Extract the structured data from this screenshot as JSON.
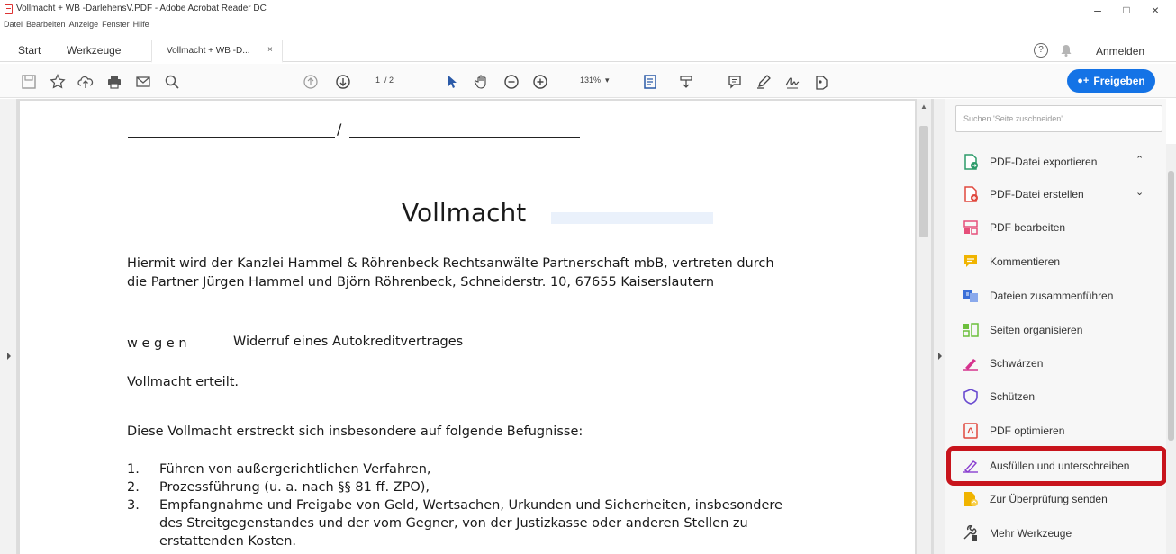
{
  "window": {
    "title": "Vollmacht + WB -DarlehensV.PDF - Adobe Acrobat Reader DC",
    "minimize": "–",
    "maximize": "□",
    "close": "×"
  },
  "menu": [
    "Datei",
    "Bearbeiten",
    "Anzeige",
    "Fenster",
    "Hilfe"
  ],
  "tabs": {
    "home": "Start",
    "tools": "Werkzeuge",
    "document": "Vollmacht + WB -D...",
    "document_close": "×",
    "signin": "Anmelden"
  },
  "toolbar": {
    "page_current": "1",
    "page_total": "/ 2",
    "zoom": "131%",
    "share_label": "Freigeben"
  },
  "document": {
    "blank_separator": "/",
    "heading": "Vollmacht",
    "intro_line1": "Hiermit wird der Kanzlei Hammel & Röhrenbeck Rechtsanwälte Partnerschaft mbB, vertreten durch",
    "intro_line2": "die Partner Jürgen Hammel und Björn Röhrenbeck, Schneiderstr. 10, 67655 Kaiserslautern",
    "wegen_label": "w e g e n",
    "wegen_value": "Widerruf eines Autokreditvertrages",
    "granted": "Vollmacht erteilt.",
    "scope_intro": "Diese Vollmacht erstreckt sich insbesondere auf folgende Befugnisse:",
    "items": [
      {
        "num": "1.",
        "text": "Führen von außergerichtlichen Verfahren,"
      },
      {
        "num": "2.",
        "text": "Prozessführung (u. a. nach §§ 81 ff. ZPO),"
      },
      {
        "num": "3.",
        "text": "Empfangnahme und Freigabe von Geld, Wertsachen,  Urkunden und Sicherheiten, insbesondere"
      }
    ],
    "item3_line2": "des Streitgegenstandes und der vom Gegner, von der Justizkasse oder anderen Stellen zu",
    "item3_line3": "erstattenden Kosten."
  },
  "tools_panel": {
    "search_placeholder": "Suchen 'Seite zuschneiden'",
    "items": [
      {
        "label": "PDF-Datei exportieren",
        "icon": "export-pdf-icon",
        "chevron": "^"
      },
      {
        "label": "PDF-Datei erstellen",
        "icon": "create-pdf-icon",
        "chevron": "v"
      },
      {
        "label": "PDF bearbeiten",
        "icon": "edit-pdf-icon"
      },
      {
        "label": "Kommentieren",
        "icon": "comment-icon"
      },
      {
        "label": "Dateien zusammenführen",
        "icon": "combine-files-icon"
      },
      {
        "label": "Seiten organisieren",
        "icon": "organize-pages-icon"
      },
      {
        "label": "Schwärzen",
        "icon": "redact-icon"
      },
      {
        "label": "Schützen",
        "icon": "protect-icon"
      },
      {
        "label": "PDF optimieren",
        "icon": "optimize-pdf-icon"
      },
      {
        "label": "Ausfüllen und unterschreiben",
        "icon": "fill-sign-icon"
      },
      {
        "label": "Zur Überprüfung senden",
        "icon": "send-review-icon"
      },
      {
        "label": "Mehr Werkzeuge",
        "icon": "more-tools-icon"
      }
    ]
  },
  "colors": {
    "accent": "#1473e6",
    "highlight": "#c8141c"
  }
}
